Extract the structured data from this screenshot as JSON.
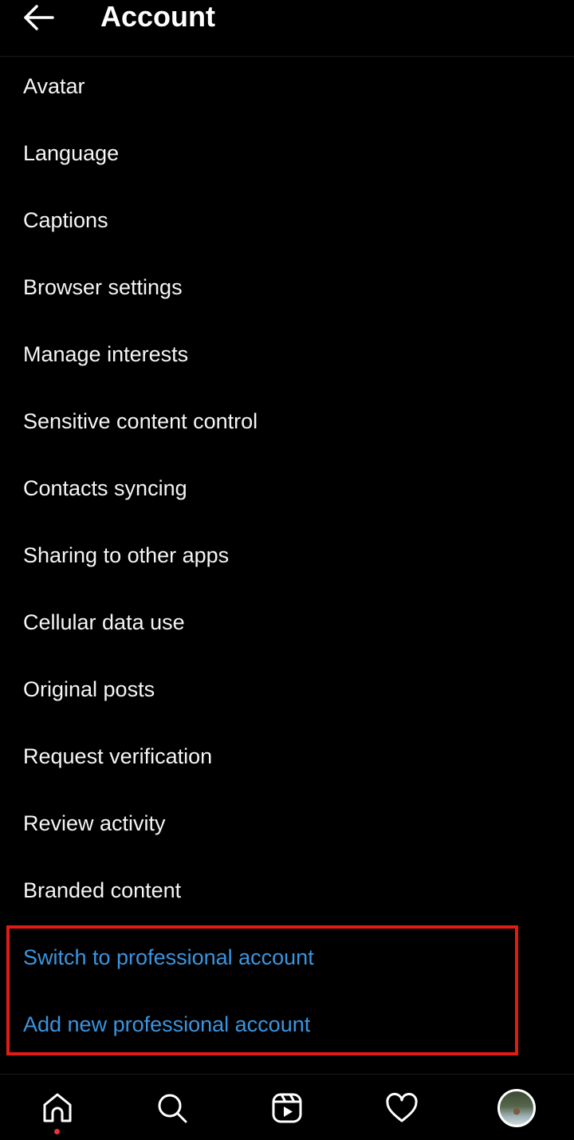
{
  "header": {
    "title": "Account",
    "back_icon": "arrow-left-icon"
  },
  "menu": [
    {
      "label": "Avatar"
    },
    {
      "label": "Language"
    },
    {
      "label": "Captions"
    },
    {
      "label": "Browser settings"
    },
    {
      "label": "Manage interests"
    },
    {
      "label": "Sensitive content control"
    },
    {
      "label": "Contacts syncing"
    },
    {
      "label": "Sharing to other apps"
    },
    {
      "label": "Cellular data use"
    },
    {
      "label": "Original posts"
    },
    {
      "label": "Request verification"
    },
    {
      "label": "Review activity"
    },
    {
      "label": "Branded content"
    }
  ],
  "professional": [
    {
      "label": "Switch to professional account"
    },
    {
      "label": "Add new professional account"
    }
  ],
  "colors": {
    "link": "#3a95e0",
    "highlight_border": "#e31b14",
    "notification_dot": "#e8323c"
  },
  "bottom_nav": [
    "home-icon",
    "search-icon",
    "reels-icon",
    "heart-icon",
    "profile-avatar"
  ]
}
